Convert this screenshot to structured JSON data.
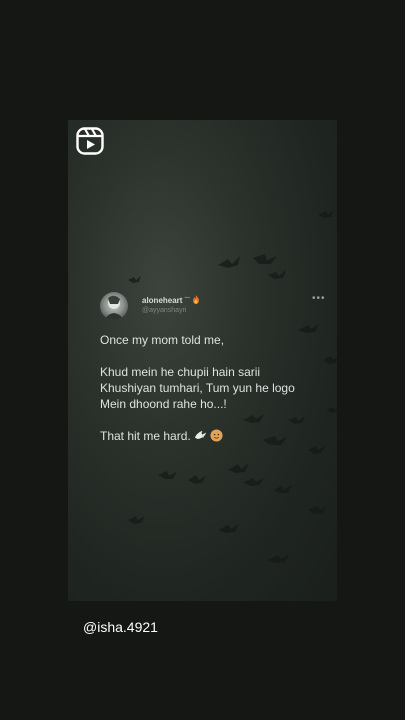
{
  "post": {
    "username": "aloneheart",
    "handle": "@ayyanshayri",
    "lines_1": "Once my mom told me,",
    "lines_2a": "Khud mein he chupii hain sarii",
    "lines_2b": "Khushiyan tumhari, Tum yun he logo",
    "lines_2c": "Mein dhoond rahe ho...!",
    "lines_3": "That hit me hard."
  },
  "creator": {
    "watermark": "@isha.4921"
  },
  "icons": {
    "reels": "reels-icon",
    "more": "more-options-icon",
    "dove": "dove-emoji",
    "face": "smiling-face-emoji",
    "fire": "fire-emoji"
  },
  "colors": {
    "background": "#141714",
    "frame": "#2b322c",
    "text": "#dfe2df"
  }
}
